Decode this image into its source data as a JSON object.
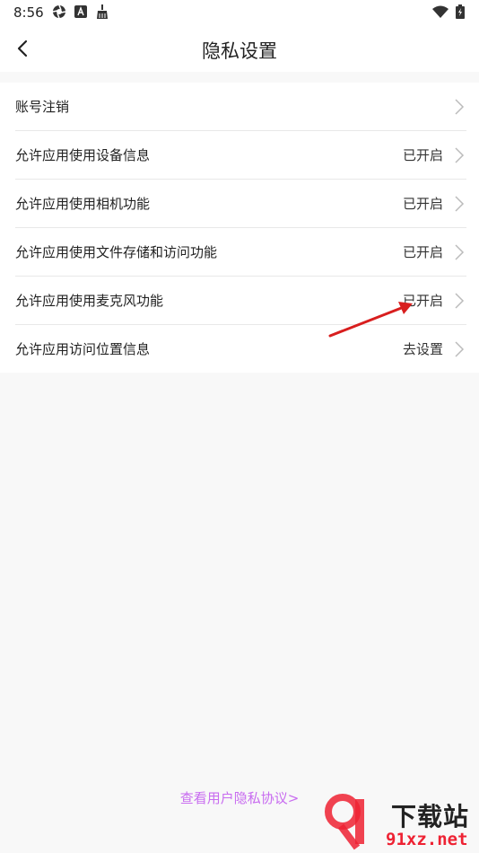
{
  "status_bar": {
    "time": "8:56"
  },
  "header": {
    "title": "隐私设置"
  },
  "settings": [
    {
      "label": "账号注销",
      "value": ""
    },
    {
      "label": "允许应用使用设备信息",
      "value": "已开启"
    },
    {
      "label": "允许应用使用相机功能",
      "value": "已开启"
    },
    {
      "label": "允许应用使用文件存储和访问功能",
      "value": "已开启"
    },
    {
      "label": "允许应用使用麦克风功能",
      "value": "已开启"
    },
    {
      "label": "允许应用访问位置信息",
      "value": "去设置"
    }
  ],
  "footer": {
    "privacy_link": "查看用户隐私协议>"
  },
  "watermark": {
    "title": "下载站",
    "url": "91xz.net"
  },
  "colors": {
    "link": "#c86cf0",
    "annotation": "#d81e1e"
  }
}
